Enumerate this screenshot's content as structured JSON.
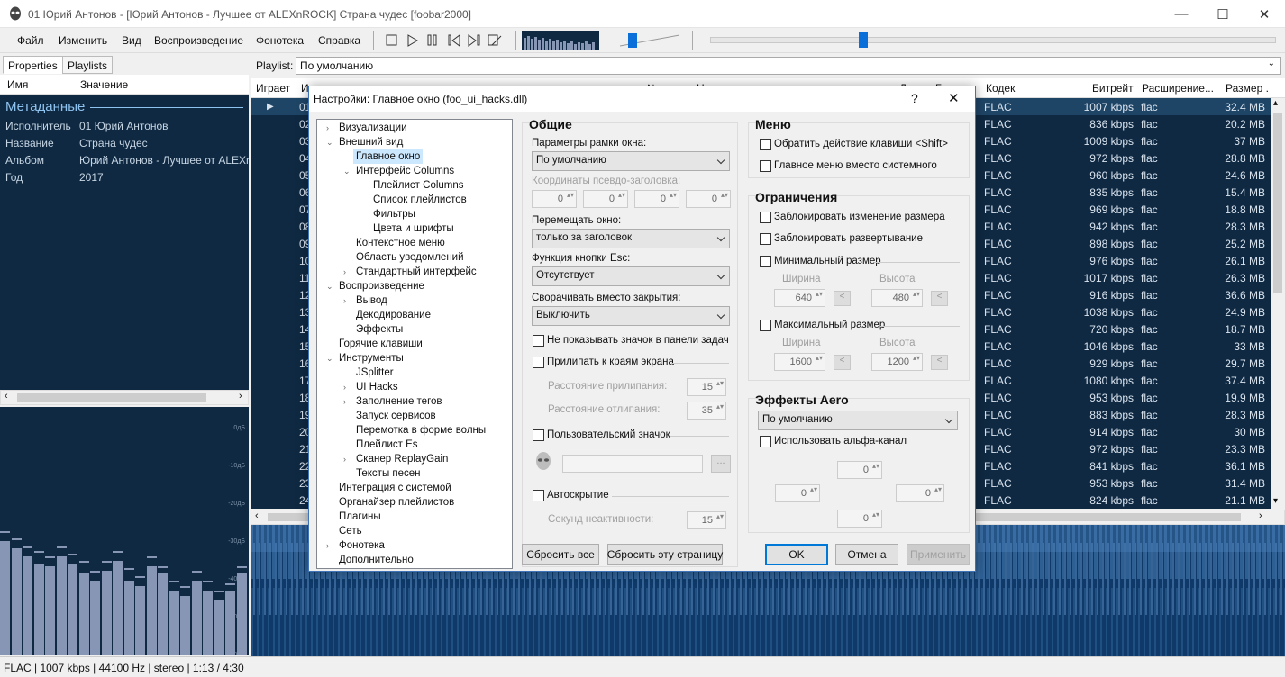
{
  "window": {
    "title": "01 Юрий Антонов - [Юрий Антонов - Лучшее от ALEXnROCK] Страна чудес  [foobar2000]"
  },
  "menu": [
    "Файл",
    "Изменить",
    "Вид",
    "Воспроизведение",
    "Фонотека",
    "Справка"
  ],
  "left": {
    "tabs": [
      "Properties",
      "Playlists"
    ],
    "headers": [
      "Имя",
      "Значение"
    ],
    "section": "Метаданные",
    "rows": [
      {
        "k": "Исполнитель",
        "v": "01 Юрий Антонов"
      },
      {
        "k": "Название",
        "v": "Страна чудес"
      },
      {
        "k": "Альбом",
        "v": "Юрий Антонов - Лучшее от ALEXn"
      },
      {
        "k": "Год",
        "v": "2017"
      }
    ],
    "db_labels": [
      "0дБ",
      "-10дБ",
      "-20дБ",
      "-30дБ",
      "-40дБ",
      "-50дБ",
      "-60дБ"
    ],
    "spectrum": [
      0.46,
      0.43,
      0.4,
      0.37,
      0.36,
      0.4,
      0.37,
      0.33,
      0.3,
      0.34,
      0.38,
      0.3,
      0.28,
      0.36,
      0.33,
      0.26,
      0.24,
      0.3,
      0.26,
      0.22,
      0.26,
      0.33
    ],
    "spectrum_peaks": [
      0.5,
      0.47,
      0.44,
      0.42,
      0.4,
      0.44,
      0.41,
      0.38,
      0.34,
      0.38,
      0.42,
      0.35,
      0.32,
      0.4,
      0.36,
      0.3,
      0.28,
      0.34,
      0.3,
      0.26,
      0.29,
      0.36
    ]
  },
  "playlist": {
    "label": "Playlist:",
    "selected": "По умолчанию",
    "columns": [
      "Играет",
      "И",
      "№",
      "Н",
      "Д",
      "Б",
      "Кодек",
      "Битрейт",
      "Расширение...",
      "Размер ."
    ],
    "rows": [
      {
        "n": "01",
        "codec": "FLAC",
        "bitrate": "1007 kbps",
        "ext": "flac",
        "size": "32.4 MB",
        "playing": true
      },
      {
        "n": "02",
        "codec": "FLAC",
        "bitrate": "836 kbps",
        "ext": "flac",
        "size": "20.2 MB"
      },
      {
        "n": "03",
        "codec": "FLAC",
        "bitrate": "1009 kbps",
        "ext": "flac",
        "size": "37 MB"
      },
      {
        "n": "04",
        "codec": "FLAC",
        "bitrate": "972 kbps",
        "ext": "flac",
        "size": "28.8 MB"
      },
      {
        "n": "05",
        "codec": "FLAC",
        "bitrate": "960 kbps",
        "ext": "flac",
        "size": "24.6 MB"
      },
      {
        "n": "06",
        "codec": "FLAC",
        "bitrate": "835 kbps",
        "ext": "flac",
        "size": "15.4 MB"
      },
      {
        "n": "07",
        "codec": "FLAC",
        "bitrate": "969 kbps",
        "ext": "flac",
        "size": "18.8 MB"
      },
      {
        "n": "08",
        "codec": "FLAC",
        "bitrate": "942 kbps",
        "ext": "flac",
        "size": "28.3 MB"
      },
      {
        "n": "09",
        "codec": "FLAC",
        "bitrate": "898 kbps",
        "ext": "flac",
        "size": "25.2 MB"
      },
      {
        "n": "10",
        "codec": "FLAC",
        "bitrate": "976 kbps",
        "ext": "flac",
        "size": "26.1 MB"
      },
      {
        "n": "11",
        "codec": "FLAC",
        "bitrate": "1017 kbps",
        "ext": "flac",
        "size": "26.3 MB"
      },
      {
        "n": "12",
        "codec": "FLAC",
        "bitrate": "916 kbps",
        "ext": "flac",
        "size": "36.6 MB"
      },
      {
        "n": "13",
        "codec": "FLAC",
        "bitrate": "1038 kbps",
        "ext": "flac",
        "size": "24.9 MB"
      },
      {
        "n": "14",
        "codec": "FLAC",
        "bitrate": "720 kbps",
        "ext": "flac",
        "size": "18.7 MB"
      },
      {
        "n": "15",
        "codec": "FLAC",
        "bitrate": "1046 kbps",
        "ext": "flac",
        "size": "33 MB"
      },
      {
        "n": "16",
        "codec": "FLAC",
        "bitrate": "929 kbps",
        "ext": "flac",
        "size": "29.7 MB"
      },
      {
        "n": "17",
        "codec": "FLAC",
        "bitrate": "1080 kbps",
        "ext": "flac",
        "size": "37.4 MB"
      },
      {
        "n": "18",
        "codec": "FLAC",
        "bitrate": "953 kbps",
        "ext": "flac",
        "size": "19.9 MB"
      },
      {
        "n": "19",
        "codec": "FLAC",
        "bitrate": "883 kbps",
        "ext": "flac",
        "size": "28.3 MB"
      },
      {
        "n": "20",
        "codec": "FLAC",
        "bitrate": "914 kbps",
        "ext": "flac",
        "size": "30 MB"
      },
      {
        "n": "21",
        "codec": "FLAC",
        "bitrate": "972 kbps",
        "ext": "flac",
        "size": "23.3 MB"
      },
      {
        "n": "22",
        "codec": "FLAC",
        "bitrate": "841 kbps",
        "ext": "flac",
        "size": "36.1 MB"
      },
      {
        "n": "23",
        "codec": "FLAC",
        "bitrate": "953 kbps",
        "ext": "flac",
        "size": "31.4 MB"
      },
      {
        "n": "24",
        "codec": "FLAC",
        "bitrate": "824 kbps",
        "ext": "flac",
        "size": "21.1 MB"
      }
    ]
  },
  "status": "FLAC | 1007 kbps | 44100 Hz | stereo | 1:13 / 4:30",
  "dialog": {
    "title": "Настройки: Главное окно (foo_ui_hacks.dll)",
    "help": "?",
    "close": "✕",
    "tree": [
      {
        "label": "Визуализации",
        "level": 0,
        "exp": ">"
      },
      {
        "label": "Внешний вид",
        "level": 0,
        "exp": "v"
      },
      {
        "label": "Главное окно",
        "level": 1,
        "sel": true
      },
      {
        "label": "Интерфейс Columns",
        "level": 1,
        "exp": "v"
      },
      {
        "label": "Плейлист Columns",
        "level": 2
      },
      {
        "label": "Список плейлистов",
        "level": 2
      },
      {
        "label": "Фильтры",
        "level": 2
      },
      {
        "label": "Цвета и шрифты",
        "level": 2
      },
      {
        "label": "Контекстное меню",
        "level": 1
      },
      {
        "label": "Область уведомлений",
        "level": 1
      },
      {
        "label": "Стандартный интерфейс",
        "level": 1,
        "exp": ">"
      },
      {
        "label": "Воспроизведение",
        "level": 0,
        "exp": "v"
      },
      {
        "label": "Вывод",
        "level": 1,
        "exp": ">"
      },
      {
        "label": "Декодирование",
        "level": 1
      },
      {
        "label": "Эффекты",
        "level": 1
      },
      {
        "label": "Горячие клавиши",
        "level": 0
      },
      {
        "label": "Инструменты",
        "level": 0,
        "exp": "v"
      },
      {
        "label": "JSplitter",
        "level": 1
      },
      {
        "label": "UI Hacks",
        "level": 1,
        "exp": ">"
      },
      {
        "label": "Заполнение тегов",
        "level": 1,
        "exp": ">"
      },
      {
        "label": "Запуск сервисов",
        "level": 1
      },
      {
        "label": "Перемотка в форме волны",
        "level": 1
      },
      {
        "label": "Плейлист Es",
        "level": 1
      },
      {
        "label": "Сканер ReplayGain",
        "level": 1,
        "exp": ">"
      },
      {
        "label": "Тексты песен",
        "level": 1
      },
      {
        "label": "Интеграция с системой",
        "level": 0
      },
      {
        "label": "Органайзер плейлистов",
        "level": 0
      },
      {
        "label": "Плагины",
        "level": 0
      },
      {
        "label": "Сеть",
        "level": 0
      },
      {
        "label": "Фонотека",
        "level": 0,
        "exp": ">"
      },
      {
        "label": "Дополнительно",
        "level": 0
      }
    ],
    "general": {
      "header": "Общие",
      "frame_label": "Параметры рамки окна:",
      "frame_value": "По умолчанию",
      "coords_label": "Координаты псевдо-заголовка:",
      "coords": [
        "0",
        "0",
        "0",
        "0"
      ],
      "move_label": "Перемещать окно:",
      "move_value": "только за заголовок",
      "esc_label": "Функция кнопки Esc:",
      "esc_value": "Отсутствует",
      "minimize_label": "Сворачивать вместо закрытия:",
      "minimize_value": "Выключить",
      "no_taskbar": "Не показывать значок в панели задач",
      "snap": "Прилипать к краям экрана",
      "snap_dist_label": "Расстояние прилипания:",
      "snap_dist": "15",
      "unsnap_label": "Расстояние отлипания:",
      "unsnap": "35",
      "custom_icon": "Пользовательский значок",
      "browse": "...",
      "autohide": "Автоскрытие",
      "inactivity_label": "Секунд неактивности:",
      "inactivity": "15"
    },
    "menu": {
      "header": "Меню",
      "shift": "Обратить действие клавиши <Shift>",
      "main_menu": "Главное меню вместо системного"
    },
    "limits": {
      "header": "Ограничения",
      "lock_resize": "Заблокировать изменение размера",
      "lock_maximize": "Заблокировать развертывание",
      "min_size": "Минимальный размер",
      "width": "Ширина",
      "height": "Высота",
      "min_w": "640",
      "min_h": "480",
      "max_size": "Максимальный размер",
      "max_w": "1600",
      "max_h": "1200",
      "lt": "<"
    },
    "aero": {
      "header": "Эффекты Aero",
      "mode": "По умолчанию",
      "alpha": "Использовать альфа-канал",
      "top": "0",
      "left": "0",
      "right": "0",
      "bottom": "0"
    },
    "buttons": {
      "reset_all": "Сбросить все",
      "reset_page": "Сбросить эту страницу",
      "ok": "OK",
      "cancel": "Отмена",
      "apply": "Применить"
    }
  }
}
